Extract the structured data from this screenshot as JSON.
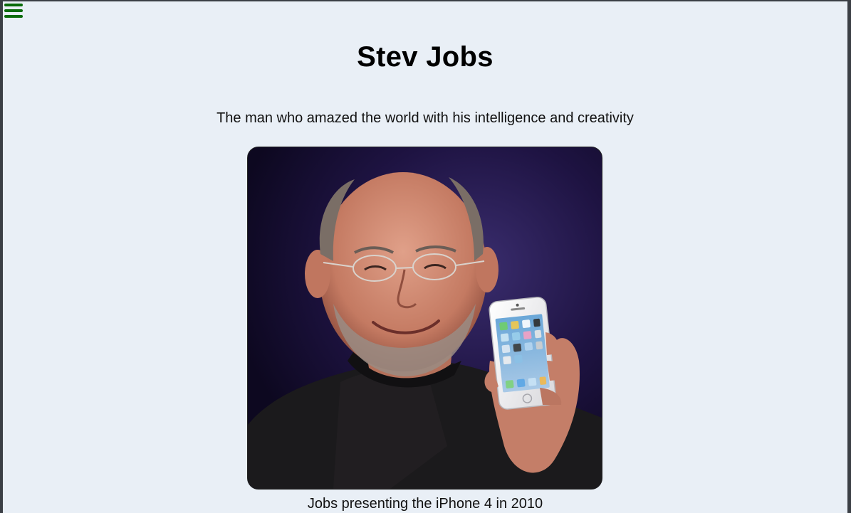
{
  "header": {
    "menu_icon": "hamburger-menu-icon",
    "menu_icon_color": "#0a6b0a"
  },
  "main": {
    "title": "Stev Jobs",
    "subtitle": "The man who amazed the world with his intelligence and creativity",
    "photo": {
      "caption": "Jobs presenting the iPhone 4 in 2010"
    }
  },
  "colors": {
    "page_background": "#e9eff6",
    "photo_background": "#140c2c"
  }
}
